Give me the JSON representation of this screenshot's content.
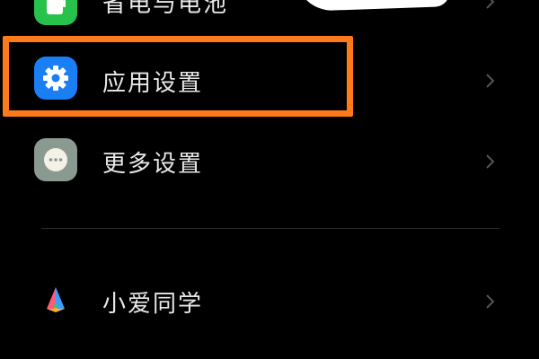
{
  "settings": {
    "items": [
      {
        "label": "省电与电池",
        "icon": "battery-icon",
        "color": "#27c24c"
      },
      {
        "label": "应用设置",
        "icon": "gear-icon",
        "color": "#1a7ff5"
      },
      {
        "label": "更多设置",
        "icon": "more-dots-icon",
        "color": "#8b9a90"
      },
      {
        "label": "小爱同学",
        "icon": "xiaoai-logo-icon",
        "color": "#ff5a5a"
      }
    ]
  },
  "annotation": {
    "highlight_color": "#ff7a1a"
  }
}
